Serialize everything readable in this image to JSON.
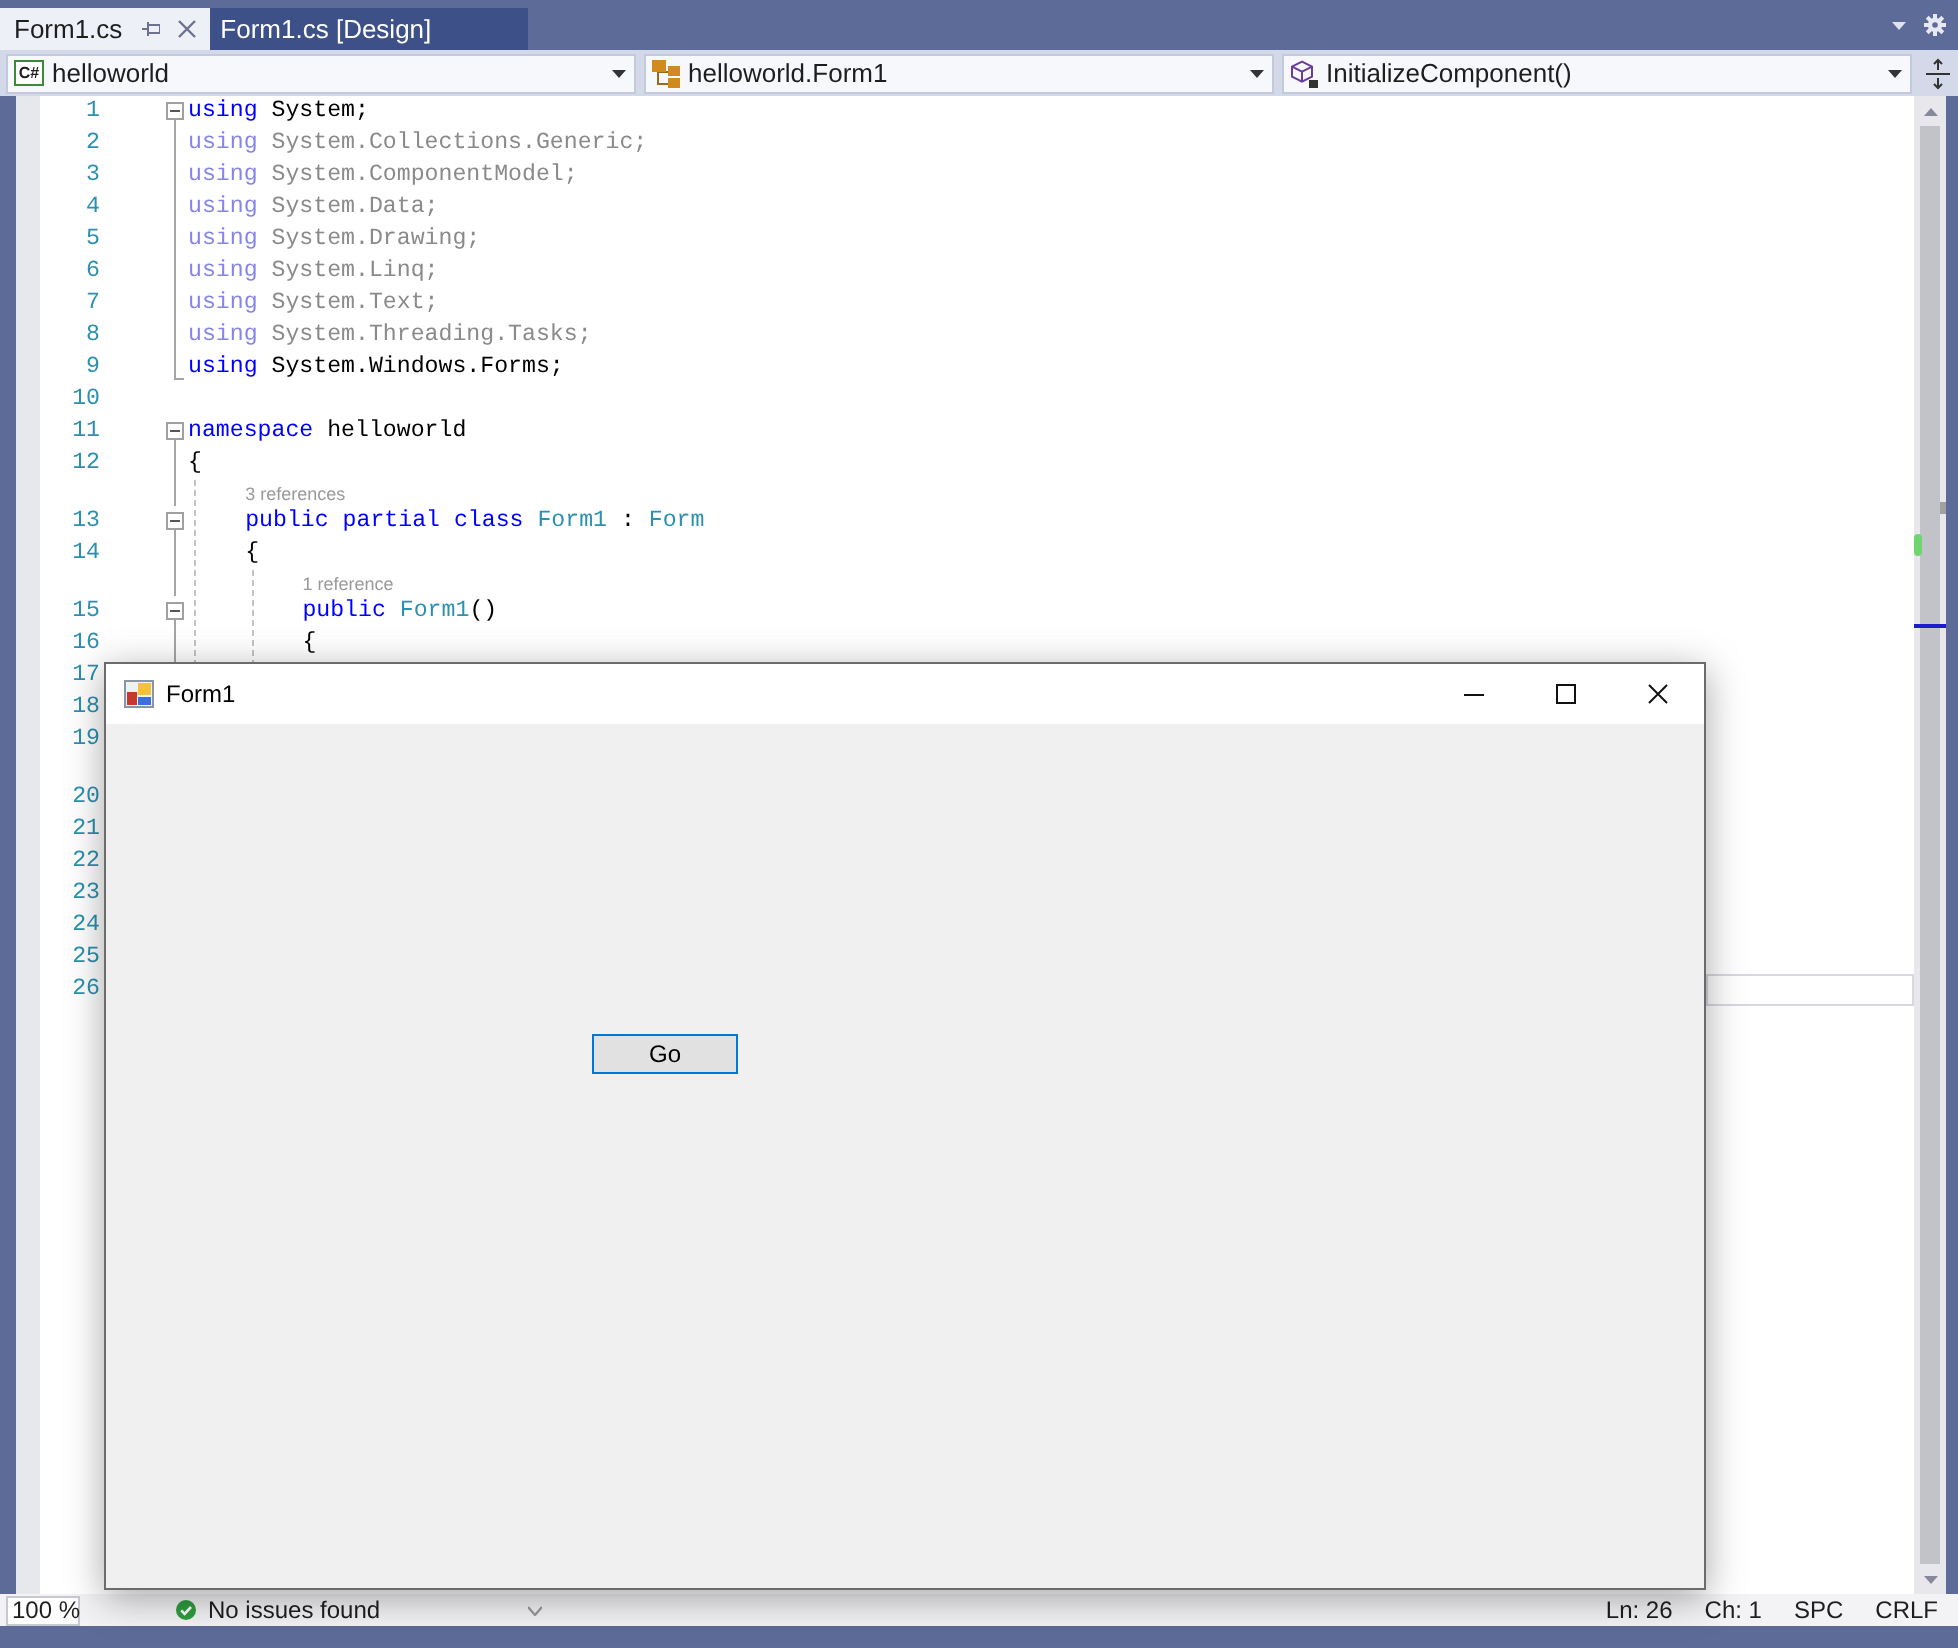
{
  "document_tabs": [
    {
      "label": "Form1.cs",
      "selected": true
    },
    {
      "label": "Form1.cs [Design]",
      "selected": false
    }
  ],
  "navigation_bar": [
    {
      "kind": "project",
      "badge": "C#",
      "text": "helloworld"
    },
    {
      "kind": "class",
      "text": "helloworld.Form1"
    },
    {
      "kind": "method",
      "text": "InitializeComponent()"
    }
  ],
  "editor": {
    "lines": [
      {
        "kind": "code",
        "number": "1",
        "expanded": true,
        "faded": false,
        "current": false,
        "tokens": [
          {
            "kind": "keyword",
            "text": "using"
          },
          {
            "kind": "plain",
            "text": " System;"
          }
        ]
      },
      {
        "kind": "code",
        "number": "2",
        "faded": true,
        "current": false,
        "tokens": [
          {
            "kind": "keyword",
            "text": "using"
          },
          {
            "kind": "plain",
            "text": " System.Collections.Generic;"
          }
        ]
      },
      {
        "kind": "code",
        "number": "3",
        "faded": true,
        "current": false,
        "tokens": [
          {
            "kind": "keyword",
            "text": "using"
          },
          {
            "kind": "plain",
            "text": " System.ComponentModel;"
          }
        ]
      },
      {
        "kind": "code",
        "number": "4",
        "faded": true,
        "current": false,
        "tokens": [
          {
            "kind": "keyword",
            "text": "using"
          },
          {
            "kind": "plain",
            "text": " System.Data;"
          }
        ]
      },
      {
        "kind": "code",
        "number": "5",
        "faded": true,
        "current": false,
        "tokens": [
          {
            "kind": "keyword",
            "text": "using"
          },
          {
            "kind": "plain",
            "text": " System.Drawing;"
          }
        ]
      },
      {
        "kind": "code",
        "number": "6",
        "faded": true,
        "current": false,
        "tokens": [
          {
            "kind": "keyword",
            "text": "using"
          },
          {
            "kind": "plain",
            "text": " System.Linq;"
          }
        ]
      },
      {
        "kind": "code",
        "number": "7",
        "faded": true,
        "current": false,
        "tokens": [
          {
            "kind": "keyword",
            "text": "using"
          },
          {
            "kind": "plain",
            "text": " System.Text;"
          }
        ]
      },
      {
        "kind": "code",
        "number": "8",
        "faded": true,
        "current": false,
        "tokens": [
          {
            "kind": "keyword",
            "text": "using"
          },
          {
            "kind": "plain",
            "text": " System.Threading.Tasks;"
          }
        ]
      },
      {
        "kind": "code",
        "number": "9",
        "fold_end": true,
        "faded": false,
        "current": false,
        "tokens": [
          {
            "kind": "keyword",
            "text": "using"
          },
          {
            "kind": "plain",
            "text": " System.Windows.Forms;"
          }
        ]
      },
      {
        "kind": "code",
        "number": "10",
        "current": false
      },
      {
        "kind": "code",
        "number": "11",
        "expanded": true,
        "faded": false,
        "current": false,
        "tokens": [
          {
            "kind": "keyword",
            "text": "namespace"
          },
          {
            "kind": "plain",
            "text": " helloworld"
          }
        ]
      },
      {
        "kind": "code",
        "number": "12",
        "faded": false,
        "current": false,
        "tokens": [
          {
            "kind": "plain",
            "text": "{"
          }
        ],
        "children": [
          {
            "kind": "lens",
            "text": "3 references"
          },
          {
            "kind": "code",
            "number": "13",
            "expanded": true,
            "faded": false,
            "current": false,
            "tokens": [
              {
                "kind": "keyword",
                "text": "public partial class"
              },
              {
                "kind": "type",
                "text": " Form1"
              },
              {
                "kind": "plain",
                "text": " : "
              },
              {
                "kind": "type",
                "text": "Form"
              }
            ]
          },
          {
            "kind": "code",
            "number": "14",
            "faded": false,
            "current": false,
            "tokens": [
              {
                "kind": "plain",
                "text": "{"
              }
            ],
            "children": [
              {
                "kind": "lens",
                "text": "1 reference"
              },
              {
                "kind": "code",
                "number": "15",
                "expanded": true,
                "faded": false,
                "current": false,
                "tokens": [
                  {
                    "kind": "keyword",
                    "text": "public"
                  },
                  {
                    "kind": "type",
                    "text": " Form1"
                  },
                  {
                    "kind": "plain",
                    "text": "()"
                  }
                ]
              },
              {
                "kind": "code",
                "number": "16",
                "faded": false,
                "current": false,
                "tokens": [
                  {
                    "kind": "plain",
                    "text": "{"
                  }
                ]
              },
              {
                "kind": "code",
                "number": "17",
                "current": false
              },
              {
                "kind": "code",
                "number": "18",
                "current": false
              },
              {
                "kind": "code",
                "number": "19",
                "current": false
              },
              {
                "kind": "lens"
              },
              {
                "kind": "code",
                "number": "20",
                "current": false
              },
              {
                "kind": "code",
                "number": "21",
                "current": false
              },
              {
                "kind": "code",
                "number": "22",
                "current": false
              },
              {
                "kind": "code",
                "number": "23",
                "current": false
              },
              {
                "kind": "code",
                "number": "24",
                "current": false
              },
              {
                "kind": "code",
                "number": "25",
                "current": false
              },
              {
                "kind": "code",
                "number": "26",
                "current": true
              }
            ]
          }
        ]
      }
    ]
  },
  "form_window": {
    "title": "Form1",
    "buttons": [
      {
        "label": "Go",
        "focused": true
      }
    ]
  },
  "status_bar": {
    "zoom": "100 %",
    "issues": "No issues found",
    "line": "Ln: 26",
    "column": "Ch: 1",
    "whitespace": "SPC",
    "line_endings": "CRLF"
  }
}
